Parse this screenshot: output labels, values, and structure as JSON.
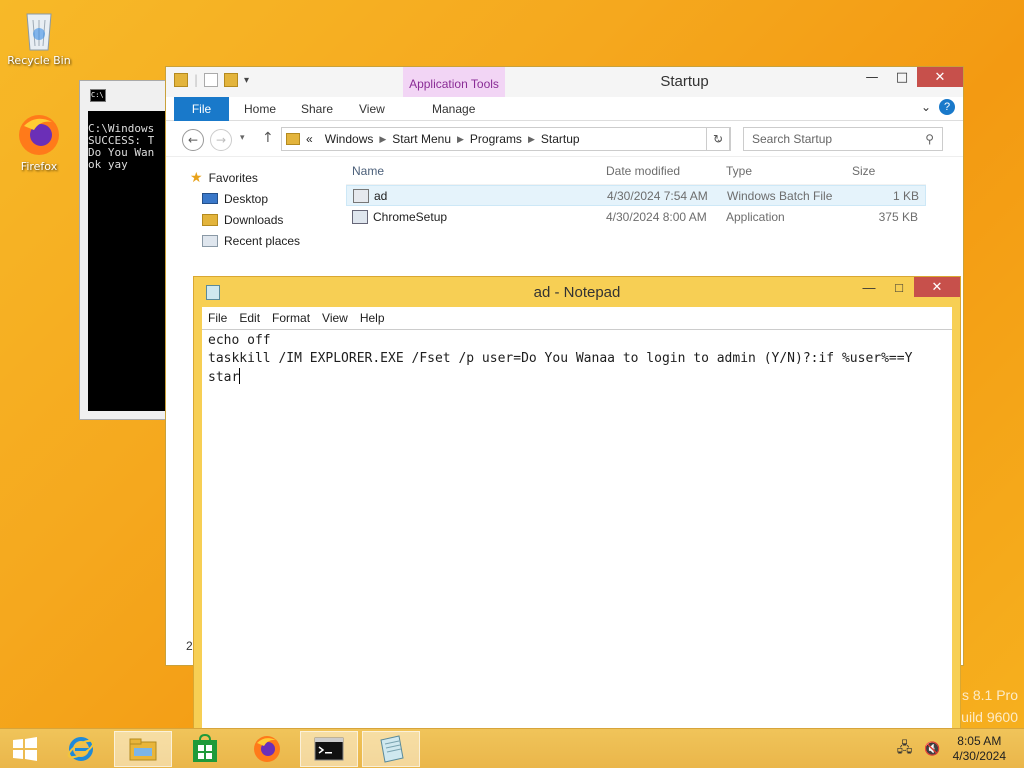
{
  "desktop": {
    "icons": [
      {
        "label": "Recycle Bin",
        "icon": "recycle-bin-icon"
      },
      {
        "label": "Firefox",
        "icon": "firefox-icon"
      }
    ],
    "watermark_line1": "s 8.1 Pro",
    "watermark_line2": "uild 9600"
  },
  "console": {
    "lines": "C:\\Windows\nSUCCESS: T\nDo You Wan\nok yay"
  },
  "explorer": {
    "title": "Startup",
    "app_tools_label": "Application Tools",
    "tabs": [
      "File",
      "Home",
      "Share",
      "View",
      "Manage"
    ],
    "breadcrumb": [
      "Windows",
      "Start Menu",
      "Programs",
      "Startup"
    ],
    "breadcrumb_prefix": "«",
    "search_placeholder": "Search Startup",
    "nav": {
      "favorites": "Favorites",
      "items": [
        "Desktop",
        "Downloads",
        "Recent places"
      ]
    },
    "columns": [
      "Name",
      "Date modified",
      "Type",
      "Size"
    ],
    "files": [
      {
        "name": "ad",
        "date": "4/30/2024 7:54 AM",
        "type": "Windows Batch File",
        "size": "1 KB"
      },
      {
        "name": "ChromeSetup",
        "date": "4/30/2024 8:00 AM",
        "type": "Application",
        "size": "375 KB"
      }
    ],
    "status_fragment": "2"
  },
  "notepad": {
    "title": "ad - Notepad",
    "menu": [
      "File",
      "Edit",
      "Format",
      "View",
      "Help"
    ],
    "content_line1": "echo off",
    "content_line2": "taskkill /IM EXPLORER.EXE /Fset /p user=Do You Wanaa to login to admin (Y/N)?:if %user%==Y",
    "content_line3": "star"
  },
  "taskbar": {
    "clock_time": "8:05 AM",
    "clock_date": "4/30/2024",
    "items": [
      "start-button",
      "internet-explorer-icon",
      "file-explorer-icon",
      "store-icon",
      "firefox-icon",
      "command-prompt-icon",
      "notepad-icon"
    ]
  },
  "colors": {
    "accent_file_tab": "#1979ca",
    "app_tools": "#f2d5f5",
    "notepad_frame": "#f7cf54",
    "close_button": "#c7504b"
  }
}
